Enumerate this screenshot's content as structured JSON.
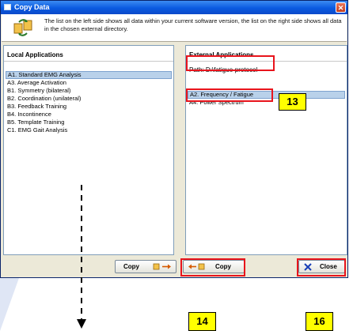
{
  "window": {
    "title": "Copy Data",
    "close_glyph": "✕",
    "info_text": "The list on the left side shows all data within your current software version, the list on the right side shows all data in the chosen external directory."
  },
  "local": {
    "header": "Local Applications",
    "items": [
      "A1. Standard EMG Analysis",
      "A3. Average Activation",
      "B1. Symmetry (bilateral)",
      "B2. Coordination (unilateral)",
      "B3. Feedback Training",
      "B4. Incontinence",
      "B5. Template Training",
      "C1. EMG Gait Analysis"
    ],
    "selected_index": 0
  },
  "external": {
    "header": "External Applications",
    "path": "Path: D:\\fatigue-protocol",
    "items": [
      "A2. Frequency / Fatigue",
      "A4. Power Spectrum"
    ],
    "selected_index": 0
  },
  "buttons": {
    "copy_left": "Copy",
    "copy_right": "Copy",
    "close": "Close"
  },
  "callouts": {
    "c13": "13",
    "c14": "14",
    "c16": "16"
  },
  "colors": {
    "highlight_red": "#e8141c",
    "callout_yellow": "#ffff00",
    "titlebar_blue": "#0a5ae0"
  },
  "icons": [
    "copy-data-icon",
    "close-icon",
    "arrow-right-icon",
    "arrow-left-icon",
    "x-close-icon"
  ]
}
